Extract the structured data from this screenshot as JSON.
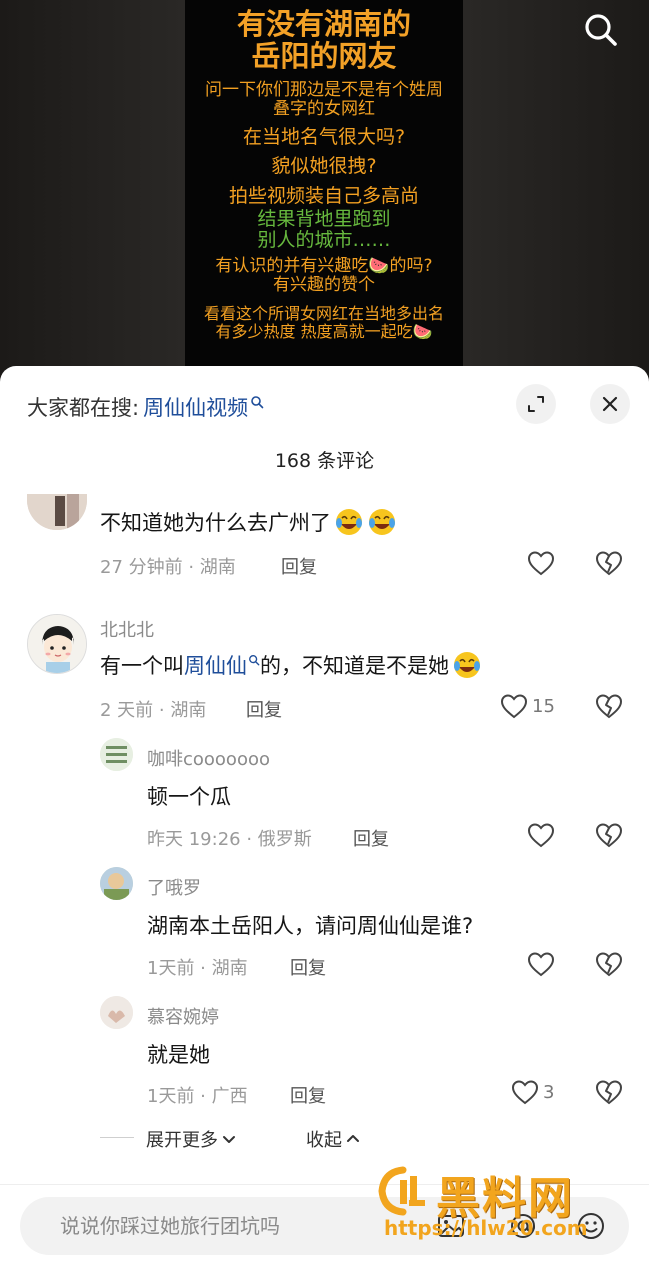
{
  "video": {
    "poster_lines": [
      "有没有湖南的",
      "岳阳的网友",
      "问一下你们那边是不是有个姓周",
      "叠字的女网红",
      "在当地名气很大吗?",
      "貌似她很拽?",
      "拍些视频装自己多高尚",
      "结果背地里跑到",
      "别人的城市……",
      "有认识的并有兴趣吃🍉的吗?",
      "有兴趣的赞个",
      "看看这个所谓女网红在当地多出名",
      "有多少热度 热度高就一起吃🍉"
    ]
  },
  "search": {
    "prefix": "大家都在搜:",
    "term": "周仙仙视频"
  },
  "comments_header": {
    "count_label": "168 条评论"
  },
  "comments": [
    {
      "username": "",
      "text": "不知道她为什么去广州了",
      "emoji": "crying-laughing-face",
      "emoji_count": 2,
      "time_location": "27 分钟前 · 湖南",
      "reply_label": "回复",
      "likes": ""
    },
    {
      "username": "北北北",
      "text_before": "有一个叫",
      "text_link": "周仙仙",
      "text_after": "的，不知道是不是她",
      "emoji": "crying-laughing-face",
      "emoji_count": 1,
      "time_location": "2 天前 · 湖南",
      "reply_label": "回复",
      "likes": "15"
    }
  ],
  "replies": [
    {
      "username": "咖啡cooooooo",
      "text": "顿一个瓜",
      "time_location": "昨天 19:26 · 俄罗斯",
      "reply_label": "回复",
      "likes": ""
    },
    {
      "username": "了哦罗",
      "text": "湖南本土岳阳人，请问周仙仙是谁?",
      "time_location": "1天前 · 湖南",
      "reply_label": "回复",
      "likes": ""
    },
    {
      "username": "慕容婉婷",
      "text": "就是她",
      "time_location": "1天前 · 广西",
      "reply_label": "回复",
      "likes": "3"
    }
  ],
  "thread_controls": {
    "expand_label": "展开更多",
    "collapse_label": "收起"
  },
  "input": {
    "placeholder": "说说你踩过她旅行团坑吗"
  },
  "watermark": {
    "title": "黑料网",
    "url": "https://hlw20.com"
  },
  "colors": {
    "poster_orange": "#f3a127",
    "poster_green": "#67b93e",
    "link_blue": "#1f4e9a",
    "watermark_orange": "#f2a51e"
  }
}
